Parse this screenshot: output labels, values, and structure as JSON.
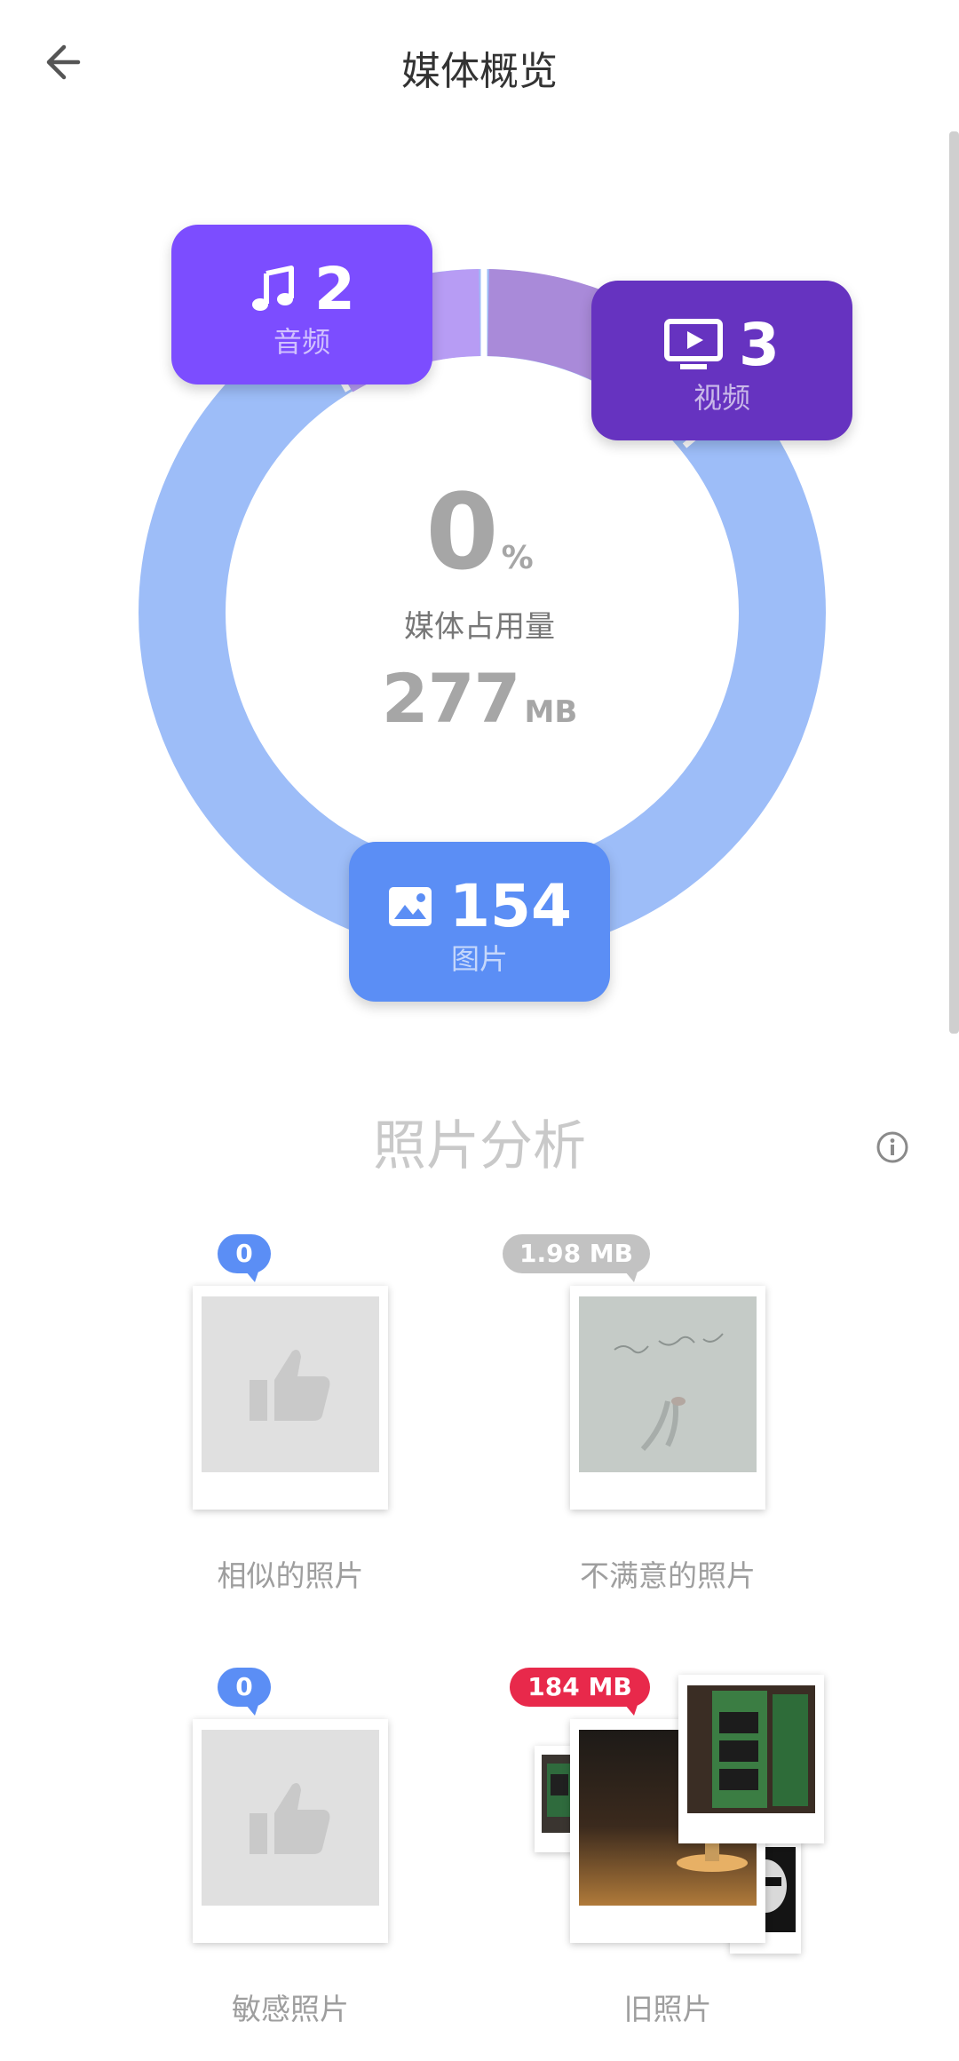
{
  "header": {
    "title": "媒体概览",
    "back_icon": "arrow-left-icon"
  },
  "summary": {
    "percent_value": "0",
    "percent_unit": "%",
    "usage_label": "媒体占用量",
    "size_value": "277",
    "size_unit": "MB"
  },
  "categories": {
    "audio": {
      "count": "2",
      "label": "音频",
      "icon": "music-note-icon",
      "color": "#7c4dff"
    },
    "video": {
      "count": "3",
      "label": "视频",
      "icon": "video-play-icon",
      "color": "#6633c0"
    },
    "photos": {
      "count": "154",
      "label": "图片",
      "icon": "image-icon",
      "color": "#5b8ef5"
    }
  },
  "ring_colors": {
    "photos": "#9dbdf8",
    "audio": "#b79cf4",
    "video": "#a98ad9"
  },
  "analysis": {
    "title": "照片分析",
    "info_icon": "info-icon",
    "tiles": [
      {
        "label": "相似的照片",
        "badge": "0",
        "badge_color": "#5b8ef5",
        "icon": "thumbs-up-icon"
      },
      {
        "label": "不满意的照片",
        "badge": "1.98 MB",
        "badge_color": "#c2c2c2"
      },
      {
        "label": "敏感照片",
        "badge": "0",
        "badge_color": "#5b8ef5",
        "icon": "thumbs-up-icon"
      },
      {
        "label": "旧照片",
        "badge": "184 MB",
        "badge_color": "#e8294b"
      }
    ]
  }
}
